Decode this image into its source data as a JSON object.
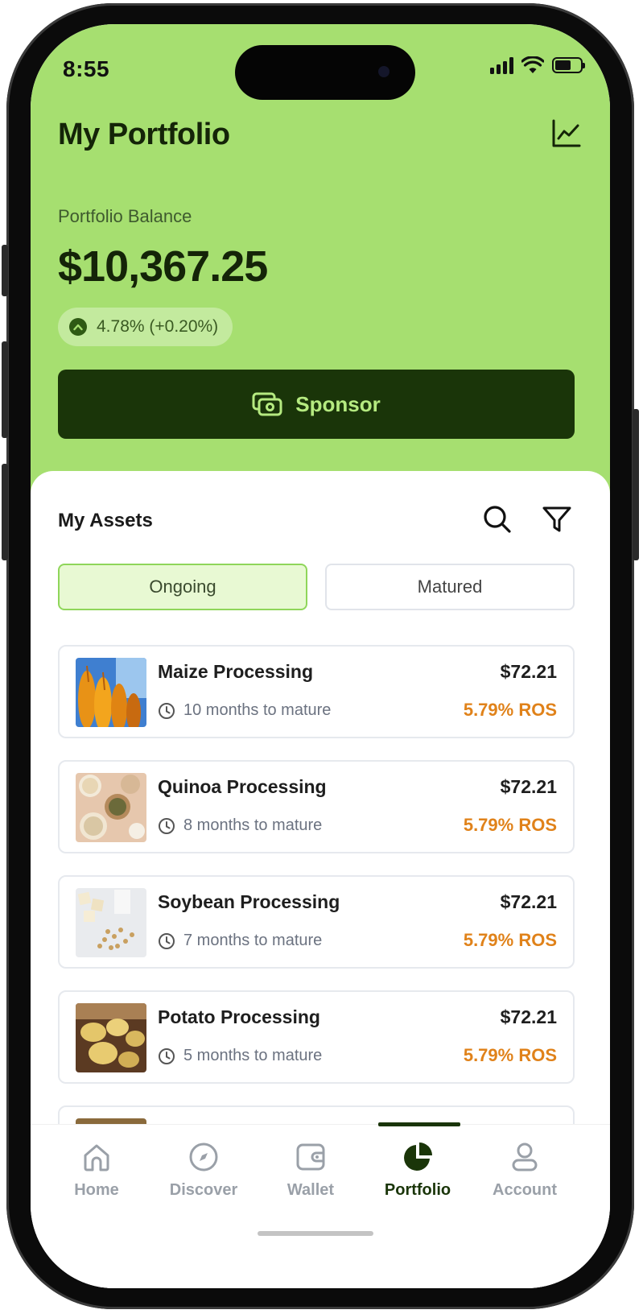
{
  "status_bar": {
    "time": "8:55"
  },
  "header": {
    "title": "My Portfolio",
    "chart_icon": "line-chart-icon"
  },
  "balance": {
    "label": "Portfolio Balance",
    "value": "$10,367.25",
    "change": "4.78% (+0.20%)"
  },
  "sponsor_button": {
    "label": "Sponsor",
    "icon": "cash-icon"
  },
  "assets": {
    "title": "My Assets",
    "tabs": [
      {
        "label": "Ongoing",
        "active": true
      },
      {
        "label": "Matured",
        "active": false
      }
    ],
    "items": [
      {
        "name": "Maize Processing",
        "maturity": "10 months to mature",
        "price": "$72.21",
        "ros": "5.79% ROS",
        "image": "maize"
      },
      {
        "name": "Quinoa Processing",
        "maturity": "8 months to mature",
        "price": "$72.21",
        "ros": "5.79% ROS",
        "image": "quinoa"
      },
      {
        "name": "Soybean Processing",
        "maturity": "7 months to mature",
        "price": "$72.21",
        "ros": "5.79% ROS",
        "image": "soybean"
      },
      {
        "name": "Potato Processing",
        "maturity": "5 months to mature",
        "price": "$72.21",
        "ros": "5.79% ROS",
        "image": "potato"
      }
    ]
  },
  "nav": {
    "items": [
      {
        "label": "Home",
        "icon": "home-icon",
        "active": false
      },
      {
        "label": "Discover",
        "icon": "compass-icon",
        "active": false
      },
      {
        "label": "Wallet",
        "icon": "wallet-icon",
        "active": false
      },
      {
        "label": "Portfolio",
        "icon": "pie-chart-icon",
        "active": true
      },
      {
        "label": "Account",
        "icon": "user-icon",
        "active": false
      }
    ]
  },
  "colors": {
    "hero_bg": "#a6df70",
    "primary_dark": "#1a3509",
    "accent_text": "#b5ea80",
    "ros_orange": "#e0821a"
  }
}
